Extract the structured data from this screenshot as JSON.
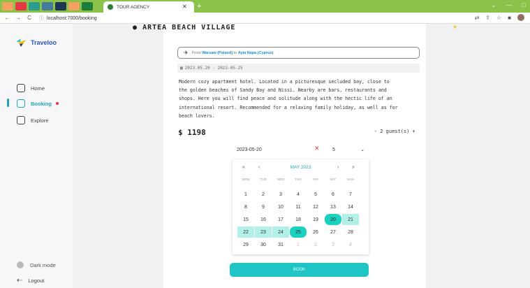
{
  "browser": {
    "tab_title": "TOUR AGENCY",
    "url": "localhost:7000/booking"
  },
  "sidebar": {
    "brand": "Traveloo",
    "items": [
      {
        "label": "Home"
      },
      {
        "label": "Booking"
      },
      {
        "label": "Explore"
      }
    ],
    "dark_mode_label": "Dark mode",
    "logout_label": "Logout"
  },
  "hotel": {
    "title": "ARTEA BEACH VILLAGE",
    "route_from_label": "From",
    "route_from": "Warsaw (Poland)",
    "route_to_label": "to",
    "route_to": "Ayia Napa (Cyprus)",
    "dates": "2023.05.20 - 2023-05-25",
    "description_lines": [
      "Modern cozy apartment hotel. Located in a picturesque secluded bay, close to",
      "the golden beaches of Sandy Bay and Nissi. Nearby are bars, restaurants and",
      "shops. Here you will find peace and solitude along with the hectic life of an",
      "international resort. Recommended for a relaxing family holiday, as well as for",
      "beach lovers."
    ],
    "price": "$ 1198",
    "guests": "2 guest(s)",
    "guest_minus": "-",
    "guest_plus": "+"
  },
  "booking": {
    "date_value": "2023-05-20",
    "nights_value": "5",
    "book_label": "BOOK"
  },
  "calendar": {
    "month": "MAY 2023",
    "weekdays": [
      "MON",
      "TUE",
      "WED",
      "THU",
      "FRI",
      "SAT",
      "SUN"
    ],
    "weeks": [
      [
        "1",
        "2",
        "3",
        "4",
        "5",
        "6",
        "7"
      ],
      [
        "8",
        "9",
        "10",
        "11",
        "12",
        "13",
        "14"
      ],
      [
        "15",
        "16",
        "17",
        "18",
        "19",
        "20",
        "21"
      ],
      [
        "22",
        "23",
        "24",
        "25",
        "26",
        "27",
        "28"
      ],
      [
        "29",
        "30",
        "31",
        "1",
        "2",
        "3",
        "4"
      ]
    ],
    "range_start": "20",
    "range_end": "25"
  },
  "colors": {
    "accent": "#1aa6b7",
    "brand": "#2a56c6",
    "selected_day": "#19d3c0",
    "range_day": "#b2f0e8",
    "book_button": "#1fc4c4"
  }
}
